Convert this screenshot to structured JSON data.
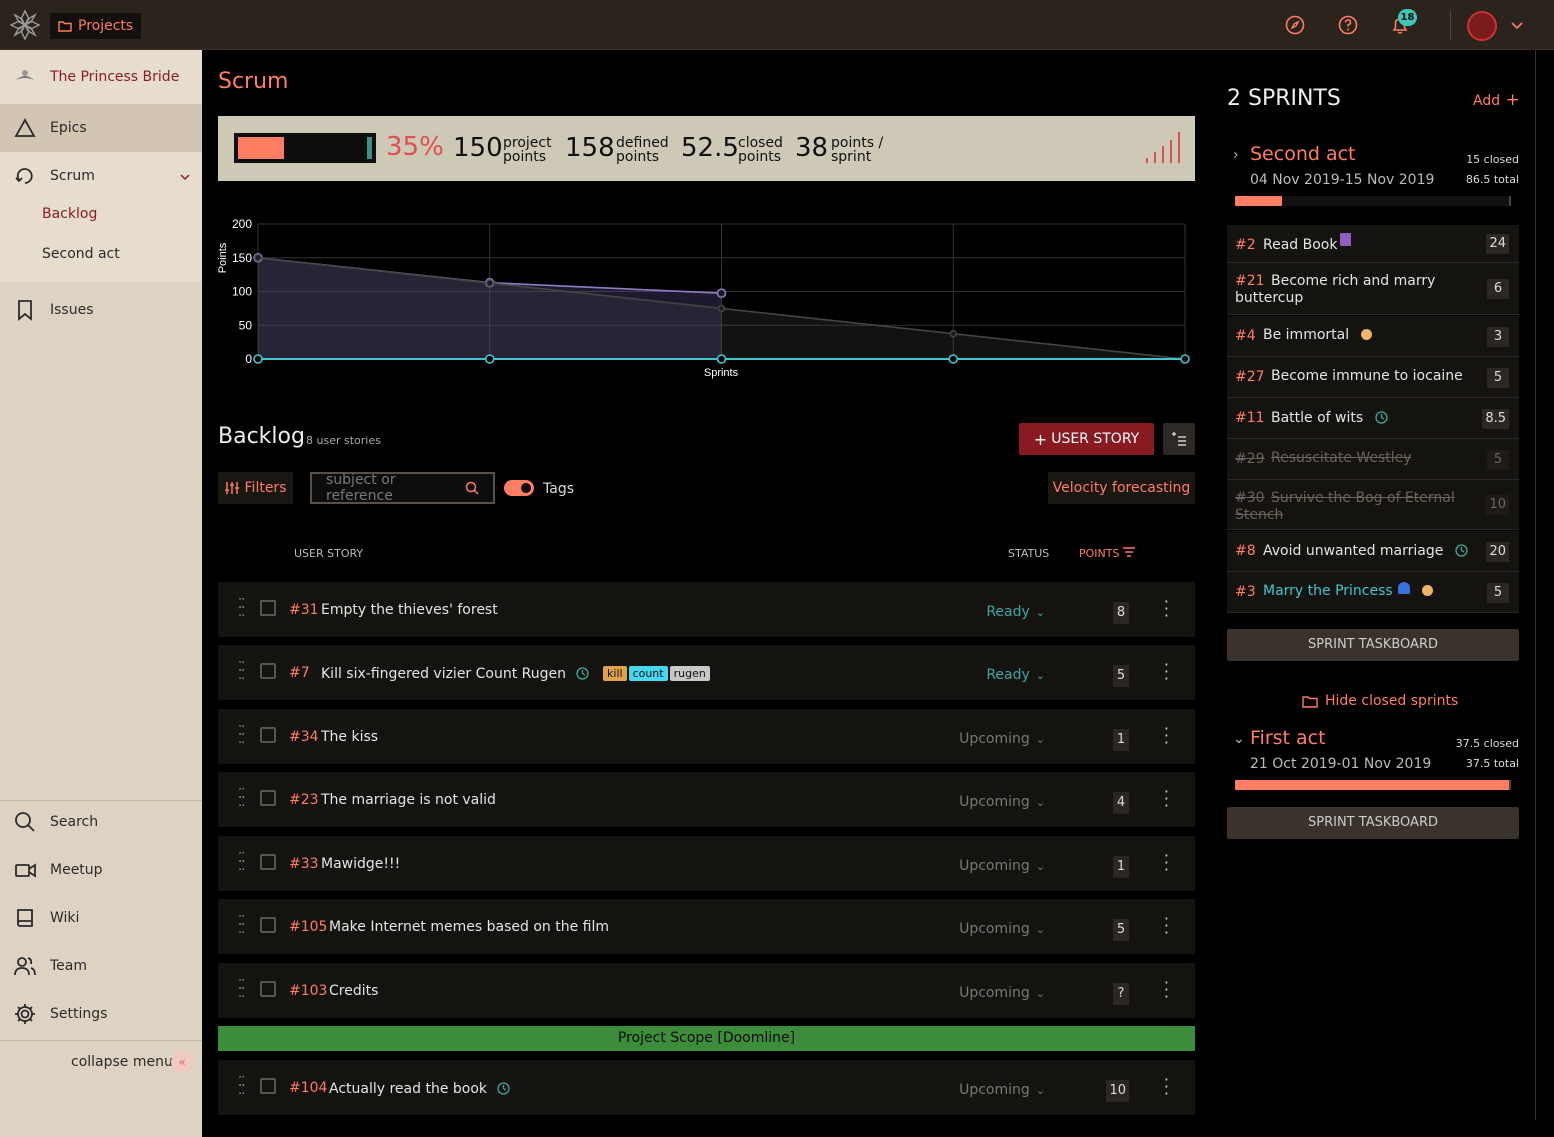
{
  "topbar": {
    "projects_label": "Projects",
    "notifications_count": "18"
  },
  "sidebar": {
    "project_name": "The Princess Bride",
    "items": [
      {
        "label": "Epics"
      },
      {
        "label": "Scrum"
      },
      {
        "label": "Issues"
      },
      {
        "label": "Search"
      },
      {
        "label": "Meetup"
      },
      {
        "label": "Wiki"
      },
      {
        "label": "Team"
      },
      {
        "label": "Settings"
      }
    ],
    "scrum_sub": [
      {
        "label": "Backlog"
      },
      {
        "label": "Second act"
      }
    ],
    "collapse_label": "collapse menu"
  },
  "main": {
    "title": "Scrum",
    "stats": {
      "progress_percent": 35,
      "percent_label": "35%",
      "project_points": "150",
      "project_points_label_1": "project",
      "project_points_label_2": "points",
      "defined_points": "158",
      "defined_points_label_1": "defined",
      "defined_points_label_2": "points",
      "closed_points": "52.5",
      "closed_points_label_1": "closed",
      "closed_points_label_2": "points",
      "points_sprint": "38",
      "points_sprint_label_1": "points /",
      "points_sprint_label_2": "sprint"
    }
  },
  "chart_data": {
    "type": "line",
    "xlabel": "Sprints",
    "ylabel": "Points",
    "ylim": [
      0,
      200
    ],
    "yticks": [
      "200",
      "150",
      "100",
      "50",
      "0"
    ],
    "x": [
      0,
      1,
      2,
      3,
      4
    ],
    "grid": true,
    "series": [
      {
        "values": [
          150,
          113,
          97.5,
          null,
          null
        ],
        "color": "#8f7cc5"
      },
      {
        "values": [
          150,
          112.5,
          75,
          37.5,
          0
        ],
        "color": "#444444"
      },
      {
        "values": [
          0,
          0,
          0,
          0,
          0
        ],
        "color": "#3ec7cf"
      }
    ]
  },
  "backlog": {
    "title": "Backlog",
    "count": "8 user stories",
    "add_label": "USER STORY",
    "filters_label": "Filters",
    "search_placeholder": "subject or reference",
    "tags_label": "Tags",
    "velocity_label": "Velocity forecasting",
    "col_user_story": "USER STORY",
    "col_status": "STATUS",
    "col_points": "POINTS",
    "doomline": "Project Scope [Doomline]",
    "stories": [
      {
        "ref": "#31",
        "subject": "Empty the thieves' forest",
        "status": "Ready",
        "points": "8"
      },
      {
        "ref": "#7",
        "subject": "Kill six-fingered vizier Count Rugen",
        "status": "Ready",
        "points": "5",
        "tags": [
          "kill",
          "count",
          "rugen"
        ]
      },
      {
        "ref": "#34",
        "subject": "The kiss",
        "status": "Upcoming",
        "points": "1"
      },
      {
        "ref": "#23",
        "subject": "The marriage is not valid",
        "status": "Upcoming",
        "points": "4"
      },
      {
        "ref": "#33",
        "subject": "Mawidge!!!",
        "status": "Upcoming",
        "points": "1"
      },
      {
        "ref": "#105",
        "subject": "Make Internet memes based on the film",
        "status": "Upcoming",
        "points": "5"
      },
      {
        "ref": "#103",
        "subject": "Credits",
        "status": "Upcoming",
        "points": "?"
      },
      {
        "ref": "#104",
        "subject": "Actually read the book",
        "status": "Upcoming",
        "points": "10"
      }
    ]
  },
  "sprints": {
    "header": "2 SPRINTS",
    "add_label": "Add",
    "hide_closed_label": "Hide closed sprints",
    "taskboard_label": "SPRINT TASKBOARD",
    "list": [
      {
        "name": "Second act",
        "dates": "04 Nov 2019-15 Nov 2019",
        "closed": "15 closed",
        "total": "86.5 total",
        "progress": 0.17,
        "stories": [
          {
            "ref": "#2",
            "subject": "Read Book",
            "points": "24"
          },
          {
            "ref": "#21",
            "subject": "Become rich and marry buttercup",
            "points": "6"
          },
          {
            "ref": "#4",
            "subject": "Be immortal",
            "points": "3"
          },
          {
            "ref": "#27",
            "subject": "Become immune to iocaine",
            "points": "5"
          },
          {
            "ref": "#11",
            "subject": "Battle of wits",
            "points": "8.5"
          },
          {
            "ref": "#29",
            "subject": "Resuscitate Westley",
            "points": "5"
          },
          {
            "ref": "#30",
            "subject": "Survive the Bog of Eternal Stench",
            "points": "10"
          },
          {
            "ref": "#8",
            "subject": "Avoid unwanted marriage",
            "points": "20"
          },
          {
            "ref": "#3",
            "subject": "Marry the Princess",
            "points": "5"
          }
        ]
      },
      {
        "name": "First act",
        "dates": "21 Oct 2019-01 Nov 2019",
        "closed": "37.5 closed",
        "total": "37.5 total",
        "progress": 1.0
      }
    ]
  },
  "colors": {
    "accent": "#ff7d63",
    "sidebar_bg": "#ded3c2",
    "ready": "#3aa7a1",
    "doomline": "#3d8c3c",
    "brand_dark": "#8a1a22"
  }
}
